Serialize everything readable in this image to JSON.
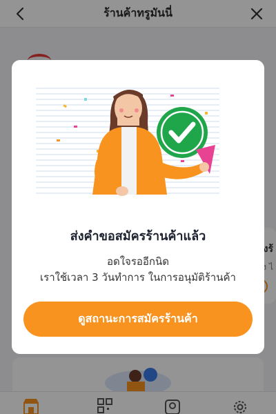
{
  "header": {
    "title": "ร้านค้าทรูมันนี่",
    "back_icon": "chevron-left-icon",
    "close_icon": "close-icon"
  },
  "background": {
    "card_text_partial_1": "งร้",
    "card_text_partial_2": "อง ไ"
  },
  "tabbar": {
    "icons": [
      "store-icon",
      "qr-code-icon",
      "user-badge-icon",
      "gear-icon"
    ],
    "active_color": "#f7931e"
  },
  "modal": {
    "illustration": "celebration-woman-checkmark-illustration",
    "title": "ส่งคำขอสมัครร้านค้าแล้ว",
    "subtitle_line1": "อดใจรออีกนิด",
    "subtitle_line2": "เราใช้เวลา 3 วันทำการ ในการอนุมัติร้านค้า",
    "cta_label": "ดูสถานะการสมัครร้านค้า"
  },
  "colors": {
    "accent": "#f7931e",
    "check_green": "#1fa64a",
    "overlay": "rgba(0,0,0,0.42)"
  }
}
